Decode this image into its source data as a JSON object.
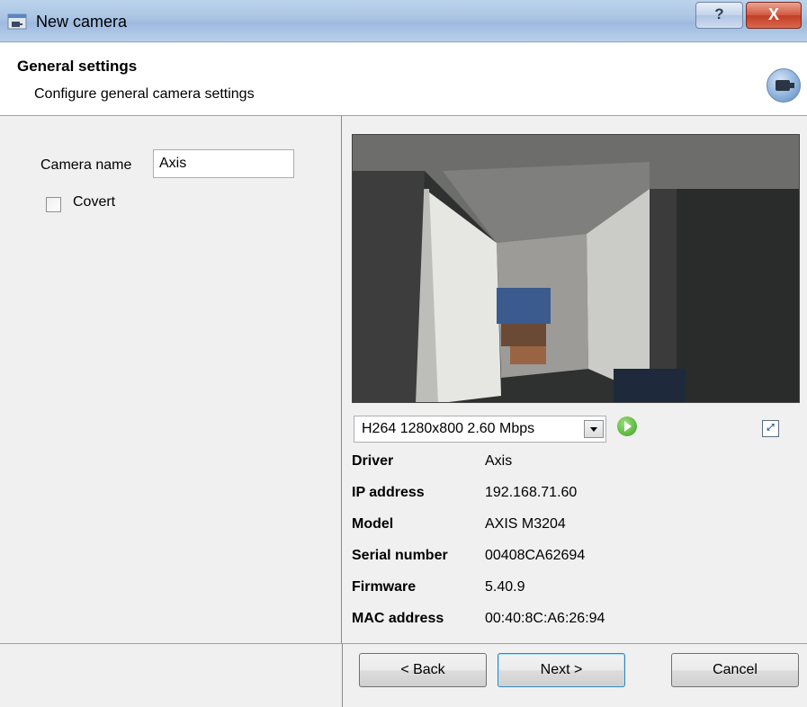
{
  "window": {
    "title": "New camera",
    "help_label": "?",
    "close_label": "X"
  },
  "header": {
    "title": "General settings",
    "subtitle": "Configure general camera settings"
  },
  "form": {
    "camera_name_label": "Camera name",
    "camera_name_value": "Axis",
    "covert_label": "Covert",
    "covert_checked": false
  },
  "stream": {
    "selected": "H264 1280x800 2.60 Mbps"
  },
  "info": [
    {
      "key": "Driver",
      "value": "Axis"
    },
    {
      "key": "IP address",
      "value": "192.168.71.60"
    },
    {
      "key": "Model",
      "value": "AXIS M3204"
    },
    {
      "key": "Serial number",
      "value": "00408CA62694"
    },
    {
      "key": "Firmware",
      "value": "5.40.9"
    },
    {
      "key": "MAC address",
      "value": "00:40:8C:A6:26:94"
    }
  ],
  "footer": {
    "back_label": "< Back",
    "next_label": "Next >",
    "cancel_label": "Cancel"
  },
  "icons": {
    "title_icon": "camera-window-icon",
    "header_icon": "camera-icon",
    "play": "play-icon",
    "fullscreen": "fullscreen-icon"
  }
}
